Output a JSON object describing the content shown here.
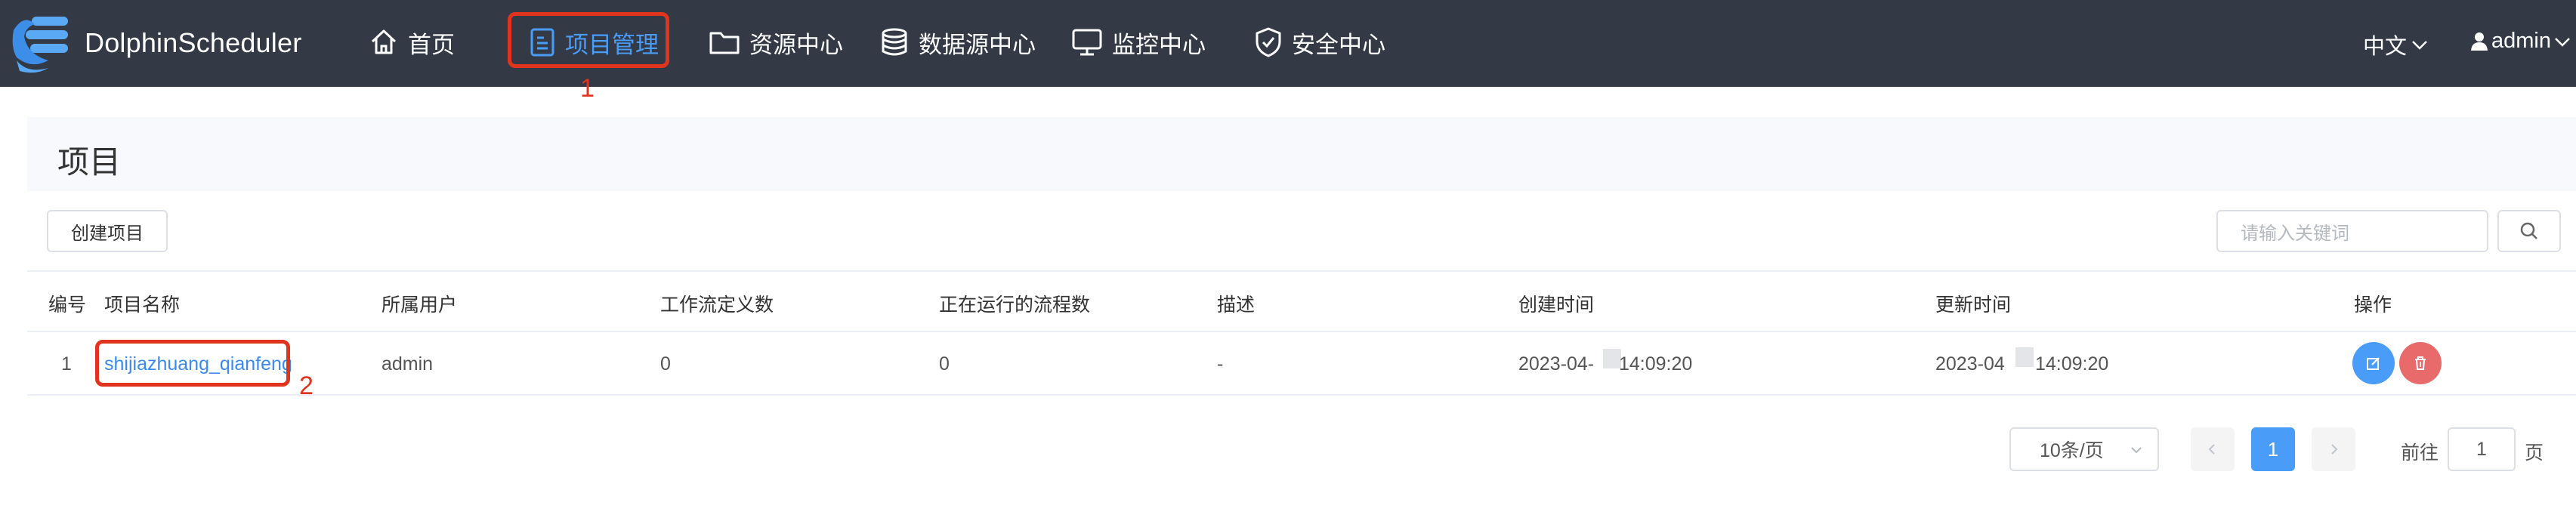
{
  "header": {
    "brand": "DolphinScheduler",
    "nav": [
      {
        "label": "首页",
        "icon": "home-icon"
      },
      {
        "label": "项目管理",
        "icon": "document-icon",
        "active": true
      },
      {
        "label": "资源中心",
        "icon": "folder-icon"
      },
      {
        "label": "数据源中心",
        "icon": "database-icon"
      },
      {
        "label": "监控中心",
        "icon": "monitor-icon"
      },
      {
        "label": "安全中心",
        "icon": "shield-icon"
      }
    ],
    "language": "中文",
    "user": "admin"
  },
  "annotations": {
    "first": "1",
    "second": "2",
    "color": "#e0341f"
  },
  "page": {
    "title": "项目",
    "create_button": "创建项目",
    "search_placeholder": "请输入关键词"
  },
  "table": {
    "headers": [
      "编号",
      "项目名称",
      "所属用户",
      "工作流定义数",
      "正在运行的流程数",
      "描述",
      "创建时间",
      "更新时间",
      "操作"
    ],
    "rows": [
      {
        "id": "1",
        "name": "shijiazhuang_qianfeng",
        "owner": "admin",
        "workflow_count": "0",
        "running_count": "0",
        "description": "-",
        "created_date": "2023-04-",
        "created_time": "14:09:20",
        "updated_date": "2023-04",
        "updated_time": "14:09:20"
      }
    ]
  },
  "pagination": {
    "page_size": "10条/页",
    "current_page": "1",
    "goto_label": "前往",
    "goto_value": "1",
    "goto_suffix": "页"
  },
  "colors": {
    "header_bg": "#333a46",
    "accent": "#4a9cf9",
    "edit": "#4a9cf9",
    "delete": "#e86a6a"
  }
}
